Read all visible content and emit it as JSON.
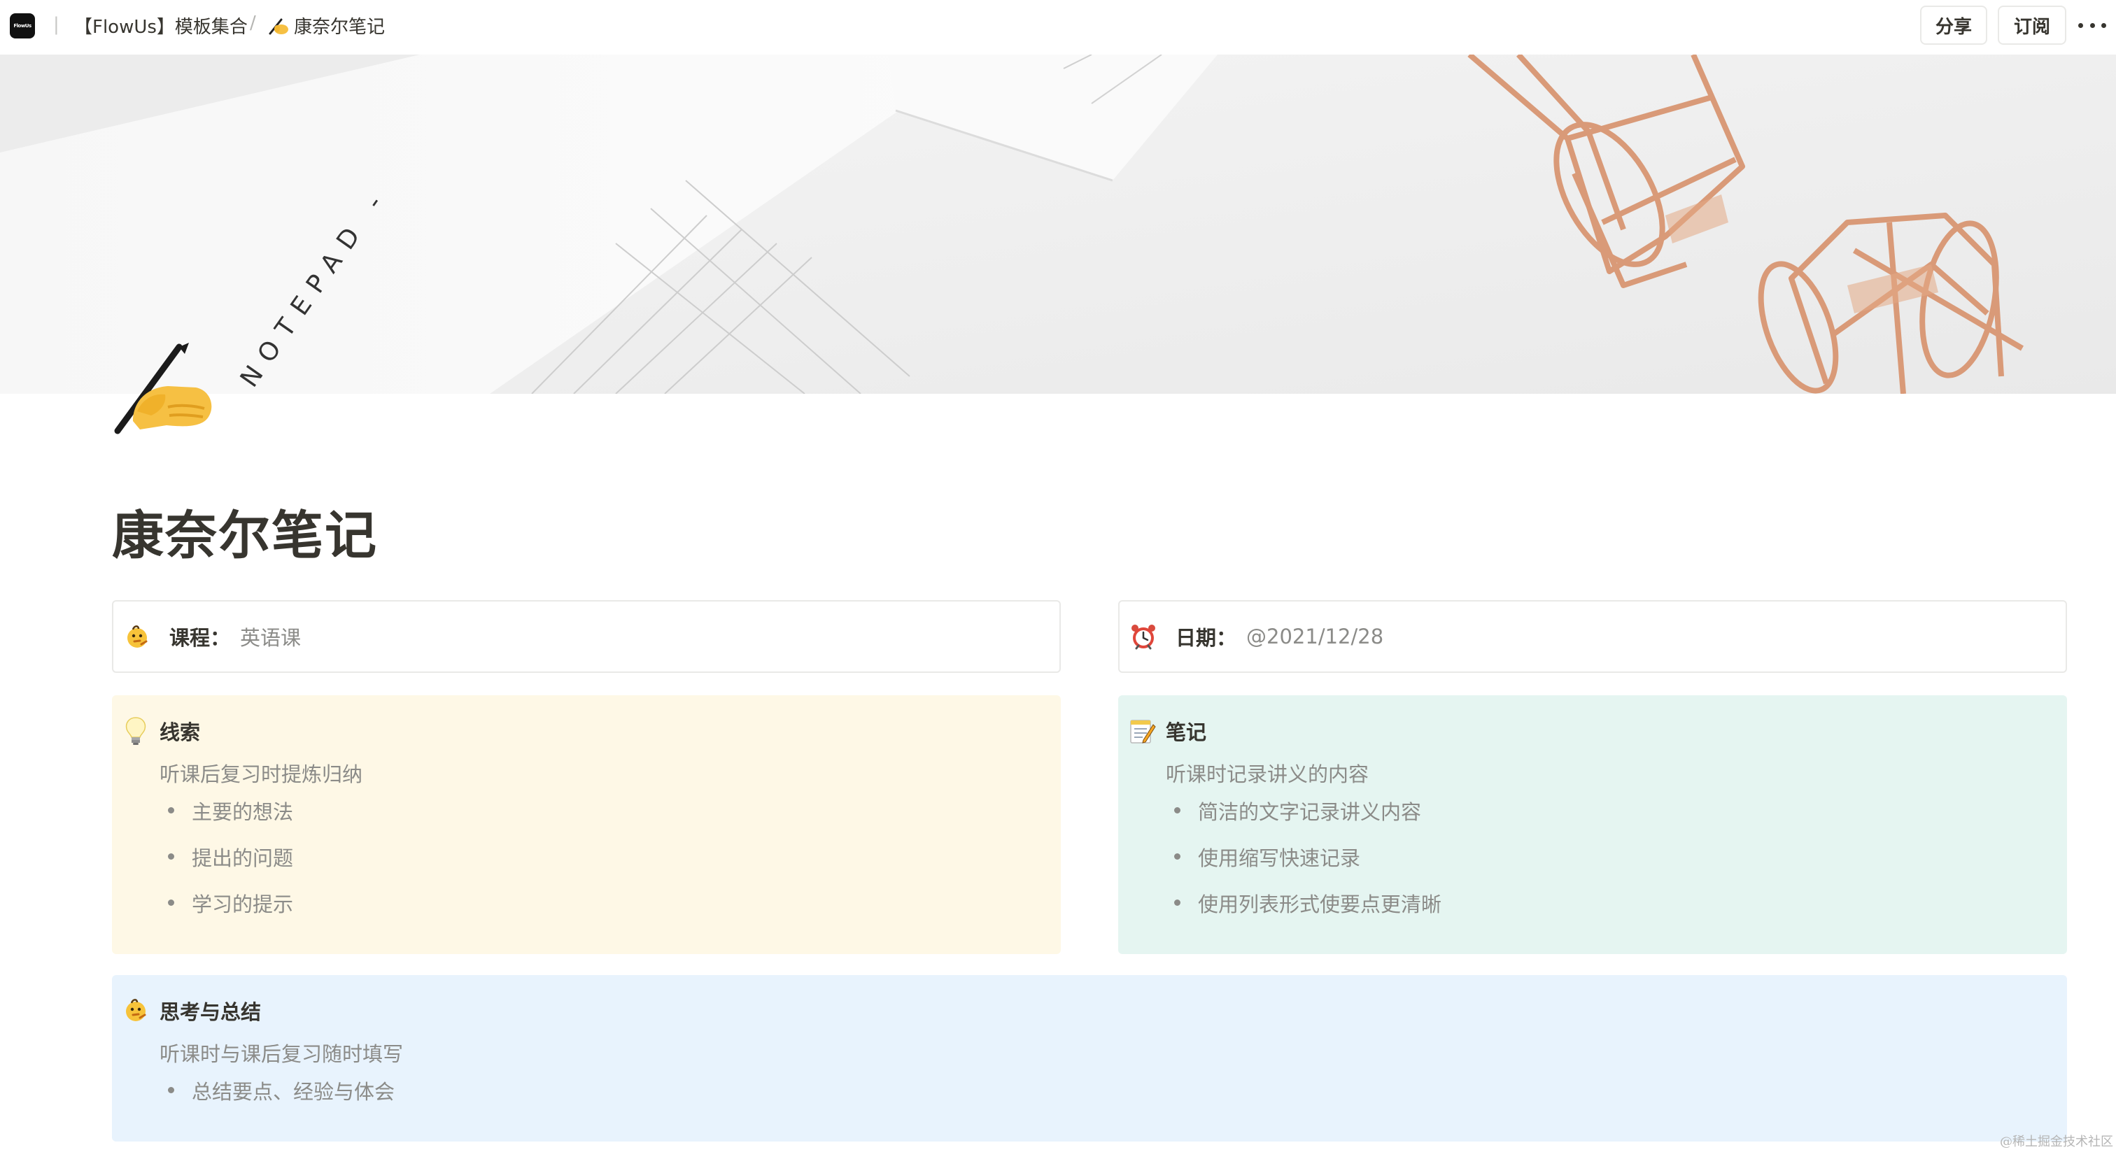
{
  "topbar": {
    "logo_text": "FlowUs",
    "breadcrumb": [
      {
        "label": "【FlowUs】模板集合"
      },
      {
        "label": "康奈尔笔记",
        "icon": "writing-hand-icon"
      }
    ],
    "separator": "/",
    "share_label": "分享",
    "subscribe_label": "订阅",
    "more_icon": "more-horizontal-icon"
  },
  "cover": {
    "notepad_text": "NOTEPAD -"
  },
  "page": {
    "icon": "writing-hand-icon",
    "title": "康奈尔笔记"
  },
  "properties": [
    {
      "icon": "thinking-chick-icon",
      "label": "课程：",
      "value": "英语课"
    },
    {
      "icon": "alarm-clock-icon",
      "label": "日期：",
      "value": "@2021/12/28"
    }
  ],
  "callouts": [
    {
      "icon": "light-bulb-icon",
      "color": "#fef8e6",
      "title": "线索",
      "subtitle": "听课后复习时提炼归纳",
      "items": [
        "主要的想法",
        "提出的问题",
        "学习的提示"
      ]
    },
    {
      "icon": "memo-icon",
      "color": "#e5f5f1",
      "title": "笔记",
      "subtitle": "听课时记录讲义的内容",
      "items": [
        "简洁的文字记录讲义内容",
        "使用缩写快速记录",
        "使用列表形式使要点更清晰"
      ]
    },
    {
      "icon": "thinking-chick-icon",
      "color": "#e8f3fd",
      "title": "思考与总结",
      "subtitle": "听课时与课后复习随时填写",
      "items": [
        "总结要点、经验与体会"
      ]
    }
  ],
  "watermark": "@稀土掘金技术社区"
}
